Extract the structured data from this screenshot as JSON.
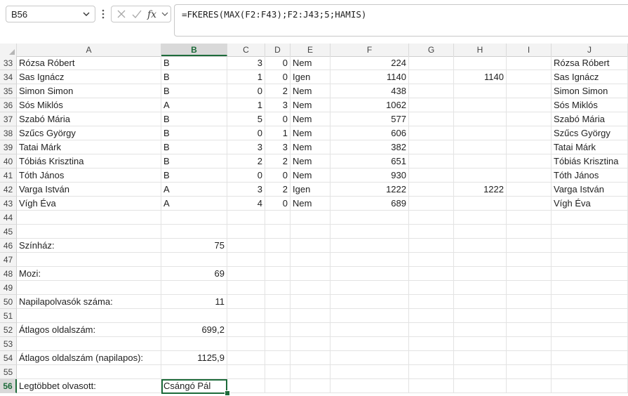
{
  "name_box": "B56",
  "formula": "=FKERES(MAX(F2:F43);F2:J43;5;HAMIS)",
  "columns": [
    "A",
    "B",
    "C",
    "D",
    "E",
    "F",
    "G",
    "H",
    "I",
    "J"
  ],
  "selected_column": "B",
  "rows": [
    {
      "n": "33",
      "A": "Rózsa Róbert",
      "B": "B",
      "C": "3",
      "D": "0",
      "E": "Nem",
      "F": "224",
      "G": "",
      "H": "",
      "I": "",
      "J": "Rózsa Róbert"
    },
    {
      "n": "34",
      "A": "Sas Ignácz",
      "B": "B",
      "C": "1",
      "D": "0",
      "E": "Igen",
      "F": "1140",
      "G": "",
      "H": "1140",
      "I": "",
      "J": "Sas Ignácz"
    },
    {
      "n": "35",
      "A": "Simon Simon",
      "B": "B",
      "C": "0",
      "D": "2",
      "E": "Nem",
      "F": "438",
      "G": "",
      "H": "",
      "I": "",
      "J": "Simon Simon"
    },
    {
      "n": "36",
      "A": "Sós Miklós",
      "B": "A",
      "C": "1",
      "D": "3",
      "E": "Nem",
      "F": "1062",
      "G": "",
      "H": "",
      "I": "",
      "J": "Sós Miklós"
    },
    {
      "n": "37",
      "A": "Szabó Mária",
      "B": "B",
      "C": "5",
      "D": "0",
      "E": "Nem",
      "F": "577",
      "G": "",
      "H": "",
      "I": "",
      "J": "Szabó Mária"
    },
    {
      "n": "38",
      "A": "Szűcs György",
      "B": "B",
      "C": "0",
      "D": "1",
      "E": "Nem",
      "F": "606",
      "G": "",
      "H": "",
      "I": "",
      "J": "Szűcs György"
    },
    {
      "n": "39",
      "A": "Tatai Márk",
      "B": "B",
      "C": "3",
      "D": "3",
      "E": "Nem",
      "F": "382",
      "G": "",
      "H": "",
      "I": "",
      "J": "Tatai Márk"
    },
    {
      "n": "40",
      "A": "Tóbiás Krisztina",
      "B": "B",
      "C": "2",
      "D": "2",
      "E": "Nem",
      "F": "651",
      "G": "",
      "H": "",
      "I": "",
      "J": "Tóbiás Krisztina"
    },
    {
      "n": "41",
      "A": "Tóth János",
      "B": "B",
      "C": "0",
      "D": "0",
      "E": "Nem",
      "F": "930",
      "G": "",
      "H": "",
      "I": "",
      "J": "Tóth János"
    },
    {
      "n": "42",
      "A": "Varga István",
      "B": "A",
      "C": "3",
      "D": "2",
      "E": "Igen",
      "F": "1222",
      "G": "",
      "H": "1222",
      "I": "",
      "J": "Varga István"
    },
    {
      "n": "43",
      "A": "Vígh Éva",
      "B": "A",
      "C": "4",
      "D": "0",
      "E": "Nem",
      "F": "689",
      "G": "",
      "H": "",
      "I": "",
      "J": "Vígh Éva"
    },
    {
      "n": "44",
      "A": "",
      "B": "",
      "C": "",
      "D": "",
      "E": "",
      "F": "",
      "G": "",
      "H": "",
      "I": "",
      "J": ""
    },
    {
      "n": "45",
      "A": "",
      "B": "",
      "C": "",
      "D": "",
      "E": "",
      "F": "",
      "G": "",
      "H": "",
      "I": "",
      "J": ""
    },
    {
      "n": "46",
      "A": "Színház:",
      "B": "75",
      "C": "",
      "D": "",
      "E": "",
      "F": "",
      "G": "",
      "H": "",
      "I": "",
      "J": ""
    },
    {
      "n": "47",
      "A": "",
      "B": "",
      "C": "",
      "D": "",
      "E": "",
      "F": "",
      "G": "",
      "H": "",
      "I": "",
      "J": ""
    },
    {
      "n": "48",
      "A": "Mozi:",
      "B": "69",
      "C": "",
      "D": "",
      "E": "",
      "F": "",
      "G": "",
      "H": "",
      "I": "",
      "J": ""
    },
    {
      "n": "49",
      "A": "",
      "B": "",
      "C": "",
      "D": "",
      "E": "",
      "F": "",
      "G": "",
      "H": "",
      "I": "",
      "J": ""
    },
    {
      "n": "50",
      "A": "Napilapolvasók száma:",
      "B": "11",
      "C": "",
      "D": "",
      "E": "",
      "F": "",
      "G": "",
      "H": "",
      "I": "",
      "J": ""
    },
    {
      "n": "51",
      "A": "",
      "B": "",
      "C": "",
      "D": "",
      "E": "",
      "F": "",
      "G": "",
      "H": "",
      "I": "",
      "J": ""
    },
    {
      "n": "52",
      "A": "Átlagos oldalszám:",
      "B": "699,2",
      "C": "",
      "D": "",
      "E": "",
      "F": "",
      "G": "",
      "H": "",
      "I": "",
      "J": ""
    },
    {
      "n": "53",
      "A": "",
      "B": "",
      "C": "",
      "D": "",
      "E": "",
      "F": "",
      "G": "",
      "H": "",
      "I": "",
      "J": ""
    },
    {
      "n": "54",
      "A": "Átlagos oldalszám (napilapos):",
      "B": "1125,9",
      "C": "",
      "D": "",
      "E": "",
      "F": "",
      "G": "",
      "H": "",
      "I": "",
      "J": ""
    },
    {
      "n": "55",
      "A": "",
      "B": "",
      "C": "",
      "D": "",
      "E": "",
      "F": "",
      "G": "",
      "H": "",
      "I": "",
      "J": ""
    },
    {
      "n": "56",
      "A": "Legtöbbet olvasott:",
      "B": "Csángó Pál",
      "C": "",
      "D": "",
      "E": "",
      "F": "",
      "G": "",
      "H": "",
      "I": "",
      "J": ""
    }
  ],
  "selected_row": "56",
  "colors": {
    "accent": "#1d6b3a",
    "header_bg": "#f3f3f3",
    "grid": "#e3e3e3"
  }
}
